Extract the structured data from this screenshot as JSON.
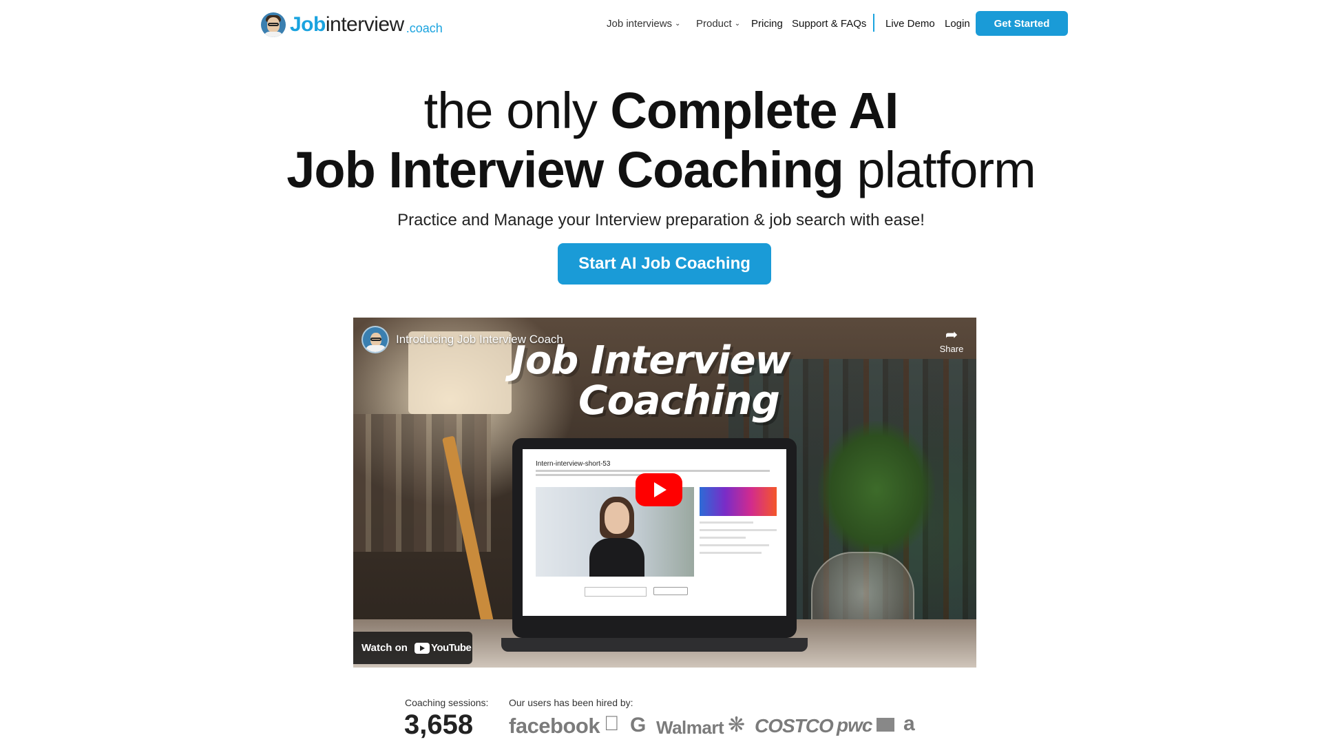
{
  "brand": {
    "name_part1": "Job",
    "name_part2": "interview",
    "name_part3": ".coach"
  },
  "nav": {
    "items": [
      {
        "label": "Job interviews",
        "dropdown": true
      },
      {
        "label": "Product",
        "dropdown": true
      },
      {
        "label": "Pricing",
        "dropdown": false
      },
      {
        "label": "Support & FAQs",
        "dropdown": false
      },
      {
        "label": "Live Demo",
        "dropdown": false
      },
      {
        "label": "Login",
        "dropdown": false
      }
    ],
    "cta": "Get Started"
  },
  "hero": {
    "line1_light": "the only ",
    "line1_bold": "Complete AI",
    "line2_bold": "Job Interview Coaching",
    "line2_light": " platform",
    "subtitle": "Practice and Manage your Interview preparation & job search with ease!",
    "cta": "Start AI Job Coaching"
  },
  "video": {
    "heading": "Introducing Job Interview Coach",
    "overlay_line1": "Job Interview",
    "overlay_line2": "Coaching",
    "share_label": "Share",
    "watch_on": "Watch on",
    "youtube_word": "YouTube",
    "screen_title": "Intern-interview-short-53"
  },
  "stats": {
    "sessions_label": "Coaching sessions:",
    "sessions_value": "3,658",
    "hired_label": "Our users has been hired by:",
    "companies": [
      "facebook",
      "Walmart",
      "COSTCO",
      "pwc",
      "a"
    ]
  },
  "colors": {
    "accent": "#1a9bd7",
    "brand_blue": "#1aa3df",
    "text": "#111111",
    "logo_grey": "#7b7b7b"
  },
  "icons": {
    "nav_dropdown": "chevron-down-icon",
    "share": "share-arrow-icon",
    "play": "youtube-play-icon"
  }
}
